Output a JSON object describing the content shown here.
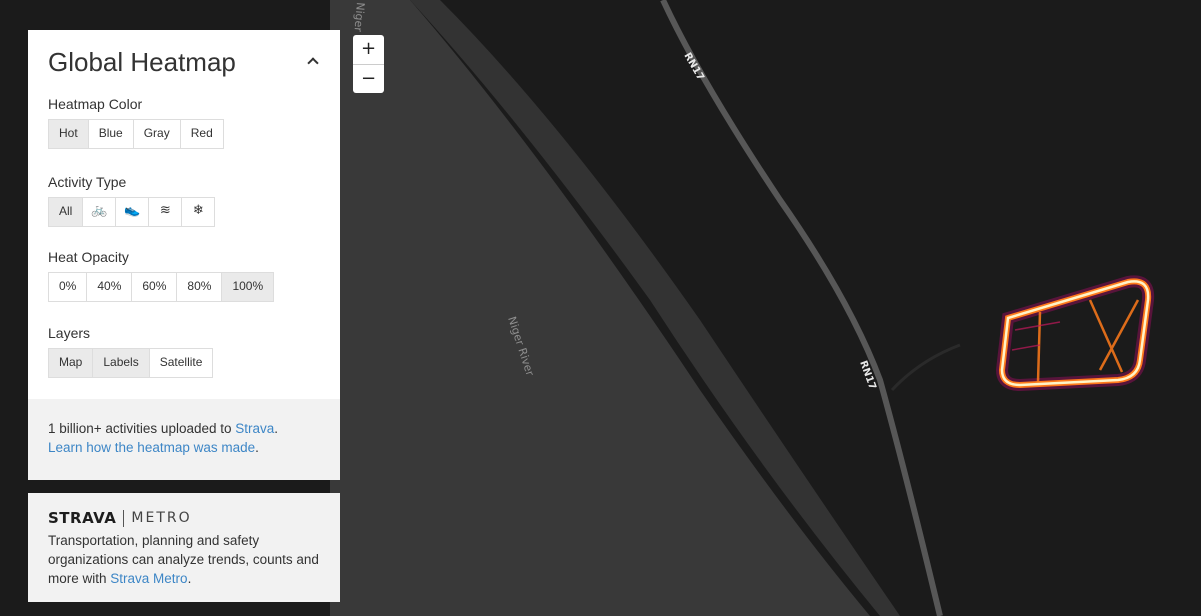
{
  "panel": {
    "title": "Global Heatmap",
    "heatmap_color": {
      "label": "Heatmap Color",
      "options": [
        "Hot",
        "Blue",
        "Gray",
        "Red"
      ],
      "selected": "Hot"
    },
    "activity_type": {
      "label": "Activity Type",
      "options": [
        "All",
        "🚲",
        "👟",
        "≋",
        "❄"
      ],
      "icons": [
        "all-label",
        "bike-icon",
        "run-shoe-icon",
        "water-waves-icon",
        "snowflake-icon"
      ],
      "selected": "All"
    },
    "heat_opacity": {
      "label": "Heat Opacity",
      "options": [
        "0%",
        "40%",
        "60%",
        "80%",
        "100%"
      ],
      "selected": "100%"
    },
    "layers": {
      "label": "Layers",
      "options": [
        "Map",
        "Labels",
        "Satellite"
      ],
      "selected": [
        "Map",
        "Labels"
      ]
    },
    "info": {
      "line1_prefix": "1 billion+ activities uploaded to ",
      "strava_link": "Strava",
      "line1_suffix": ".",
      "learn_link": "Learn how the heatmap was made",
      "line2_suffix": "."
    }
  },
  "metro": {
    "brand": "STRAVA",
    "product": "METRO",
    "text": "Transportation, planning and safety organizations can analyze trends, counts and more with ",
    "link": "Strava Metro",
    "suffix": "."
  },
  "zoom": {
    "in": "+",
    "out": "−"
  },
  "map": {
    "labels": {
      "river": "Niger River",
      "river_top": "Niger",
      "road_top": "RN17",
      "road_mid": "RN17"
    },
    "colors": {
      "background": "#1b1b1b",
      "river": "#3a3a3a",
      "road": "#575757",
      "heat_core": "#fff4c8",
      "heat_mid": "#ff7a1a",
      "heat_edge": "#8a0f55"
    }
  }
}
